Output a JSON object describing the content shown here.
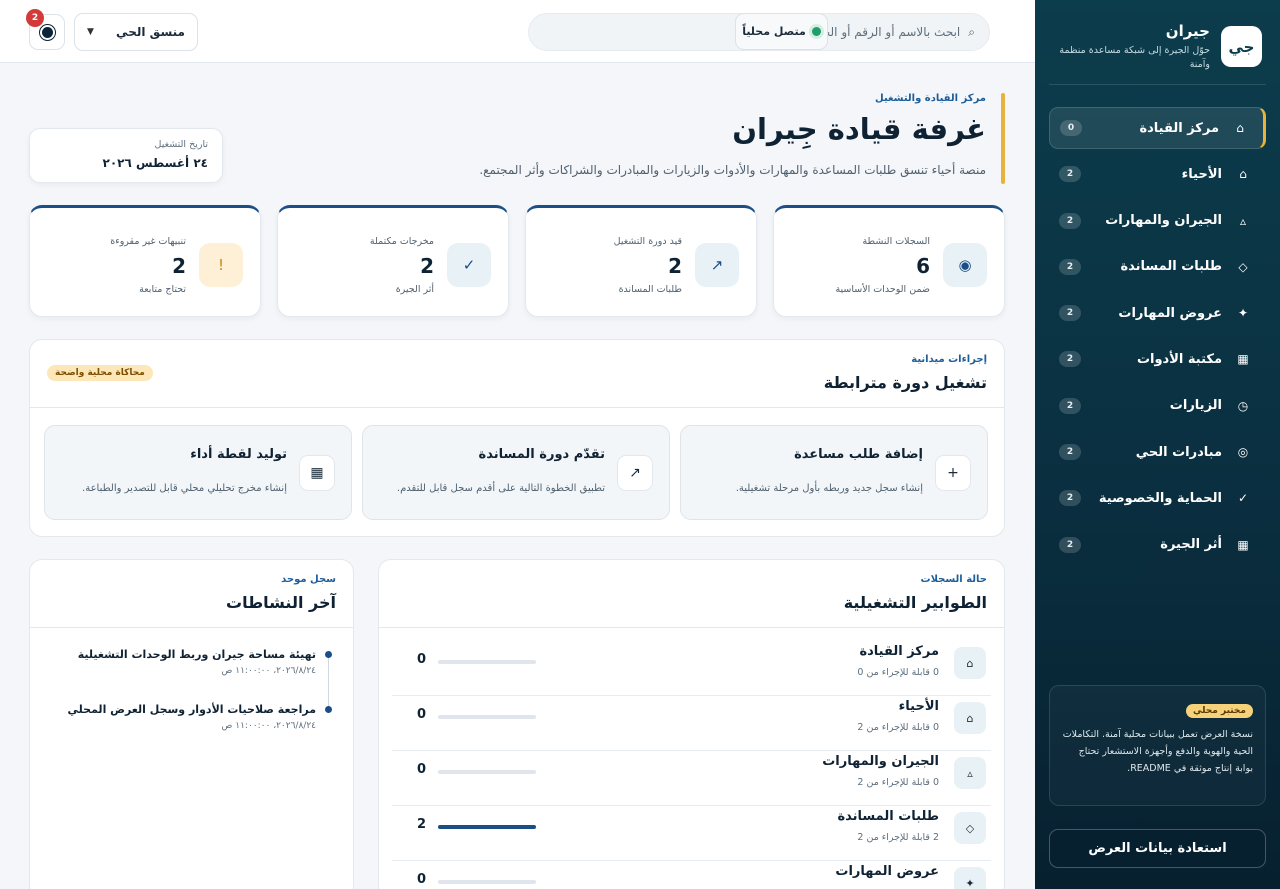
{
  "sidebar": {
    "logo": "جي",
    "brand_name": "جيران",
    "brand_tagline": "حوّل الجيرة إلى شبكة مساعدة منظمة وآمنة",
    "items": [
      {
        "label": "مركز القيادة",
        "count": "0",
        "icon": "home-icon",
        "glyph": "⌂",
        "active": true
      },
      {
        "label": "الأحياء",
        "count": "2",
        "icon": "home-icon",
        "glyph": "⌂"
      },
      {
        "label": "الجيران والمهارات",
        "count": "2",
        "icon": "triangle-icon",
        "glyph": "▵"
      },
      {
        "label": "طلبات المساندة",
        "count": "2",
        "icon": "diamond-icon",
        "glyph": "◇"
      },
      {
        "label": "عروض المهارات",
        "count": "2",
        "icon": "sparkle-icon",
        "glyph": "✦"
      },
      {
        "label": "مكتبة الأدوات",
        "count": "2",
        "icon": "grid-icon",
        "glyph": "▦"
      },
      {
        "label": "الزيارات",
        "count": "2",
        "icon": "clock-icon",
        "glyph": "◷"
      },
      {
        "label": "مبادرات الحي",
        "count": "2",
        "icon": "target-icon",
        "glyph": "◎"
      },
      {
        "label": "الحماية والخصوصية",
        "count": "2",
        "icon": "check-icon",
        "glyph": "✓"
      },
      {
        "label": "أثر الجيرة",
        "count": "2",
        "icon": "chart-icon",
        "glyph": "▦"
      }
    ],
    "lab_badge": "مختبر محلي",
    "lab_text": "نسخة العرض تعمل ببيانات محلية آمنة. التكاملات الحية والهوية والدفع وأجهزة الاستشعار تحتاج بوابة إنتاج موثقة في README.",
    "restore_label": "استعادة بيانات العرض"
  },
  "topbar": {
    "search_placeholder": "ابحث بالاسم أو الرقم أو الحالة...",
    "connection": "متصل محلياً",
    "role": "منسق الحي",
    "notifications": "2"
  },
  "header": {
    "eyebrow": "مركز القيادة والتشغيل",
    "title": "غرفة قيادة جِيران",
    "subtitle": "منصة أحياء تنسق طلبات المساعدة والمهارات والأدوات والزيارات والمبادرات والشراكات وأثر المجتمع.",
    "date_label": "تاريخ التشغيل",
    "date_value": "٢٤ أغسطس ٢٠٢٦"
  },
  "stats": [
    {
      "label": "السجلات النشطة",
      "value": "6",
      "note": "ضمن الوحدات الأساسية",
      "icon": "record-icon",
      "glyph": "◉"
    },
    {
      "label": "قيد دورة التشغيل",
      "value": "2",
      "note": "طلبات المساندة",
      "icon": "arrow-icon",
      "glyph": "↗"
    },
    {
      "label": "مخرجات مكتملة",
      "value": "2",
      "note": "أثر الجيرة",
      "icon": "check-icon",
      "glyph": "✓"
    },
    {
      "label": "تنبيهات غير مقروءة",
      "value": "2",
      "note": "تحتاج متابعة",
      "icon": "alert-icon",
      "glyph": "!"
    }
  ],
  "actions": {
    "eyebrow": "إجراءات ميدانية",
    "title": "تشغيل دورة مترابطة",
    "badge": "محاكاة محلية واضحة",
    "cards": [
      {
        "title": "إضافة طلب مساعدة",
        "desc": "إنشاء سجل جديد وربطه بأول مرحلة تشغيلية.",
        "icon": "plus-icon",
        "glyph": "+"
      },
      {
        "title": "تقدّم دورة المساندة",
        "desc": "تطبيق الخطوة التالية على أقدم سجل قابل للتقدم.",
        "icon": "arrow-icon",
        "glyph": "↗"
      },
      {
        "title": "توليد لقطة أداء",
        "desc": "إنشاء مخرج تحليلي محلي قابل للتصدير والطباعة.",
        "icon": "grid-icon",
        "glyph": "▦"
      }
    ]
  },
  "queues": {
    "eyebrow": "حالة السجلات",
    "title": "الطوابير التشغيلية",
    "rows": [
      {
        "name": "مركز القيادة",
        "note": "0 قابلة للإجراء من 0",
        "value": "0",
        "progress": 0,
        "glyph": "⌂"
      },
      {
        "name": "الأحياء",
        "note": "0 قابلة للإجراء من 2",
        "value": "0",
        "progress": 0,
        "glyph": "⌂"
      },
      {
        "name": "الجيران والمهارات",
        "note": "0 قابلة للإجراء من 2",
        "value": "0",
        "progress": 0,
        "glyph": "▵"
      },
      {
        "name": "طلبات المساندة",
        "note": "2 قابلة للإجراء من 2",
        "value": "2",
        "progress": 1,
        "glyph": "◇"
      },
      {
        "name": "عروض المهارات",
        "note": "",
        "value": "0",
        "progress": 0,
        "glyph": "✦"
      }
    ]
  },
  "activity": {
    "eyebrow": "سجل موحد",
    "title": "آخر النشاطات",
    "items": [
      {
        "text": "تهيئة مساحة جيران وربط الوحدات التشغيلية",
        "time": "٢٠٢٦/٨/٢٤، ١١:٠٠:٠٠ ص"
      },
      {
        "text": "مراجعة صلاحيات الأدوار وسجل العرض المحلي",
        "time": "٢٠٢٦/٨/٢٤، ١١:٠٠:٠٠ ص"
      }
    ]
  },
  "colors": {
    "accent": "#e9b23a",
    "primary": "#1b4e86",
    "sidebar": "#0c3d4c",
    "alert": "#d33b3b"
  }
}
